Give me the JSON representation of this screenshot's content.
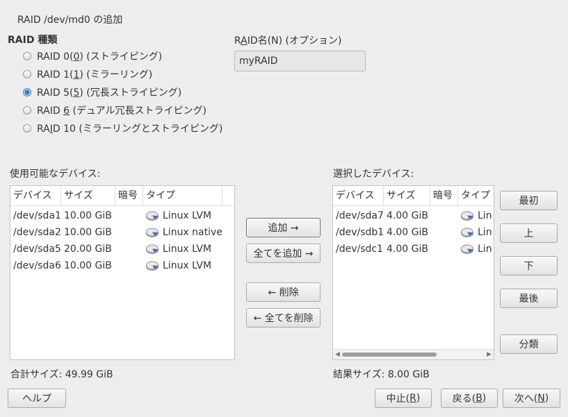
{
  "window": {
    "title": "RAID /dev/md0 の追加"
  },
  "raid_type": {
    "group_label": "RAID 種類",
    "options": [
      {
        "pre": "RAID 0(",
        "key": "0",
        "post": ")  (ストライピング)",
        "checked": false
      },
      {
        "pre": "RAID 1(",
        "key": "1",
        "post": ")  (ミラーリング)",
        "checked": false
      },
      {
        "pre": "RAID 5(",
        "key": "5",
        "post": ")  (冗長ストライピング)",
        "checked": true
      },
      {
        "pre": "RAID ",
        "key": "6",
        "post": " (デュアル冗長ストライピング)",
        "checked": false
      },
      {
        "pre": "RA",
        "key": "I",
        "post": "D 10  (ミラーリングとストライピング)",
        "checked": false
      }
    ]
  },
  "raid_name": {
    "label_pre": "R",
    "label_key": "A",
    "label_post": "ID名(N) (オプション)",
    "value": "myRAID"
  },
  "available": {
    "label": "使用可能なデバイス:",
    "columns": [
      "デバイス",
      "サイズ",
      "暗号",
      "タイプ"
    ],
    "rows": [
      {
        "device": "/dev/sda1",
        "size": "10.00 GiB",
        "enc": "",
        "type": "Linux LVM"
      },
      {
        "device": "/dev/sda2",
        "size": "10.00 GiB",
        "enc": "",
        "type": "Linux native"
      },
      {
        "device": "/dev/sda5",
        "size": "20.00 GiB",
        "enc": "",
        "type": "Linux LVM"
      },
      {
        "device": "/dev/sda6",
        "size": "10.00 GiB",
        "enc": "",
        "type": "Linux LVM"
      }
    ],
    "total": "合計サイズ: 49.99 GiB"
  },
  "selected": {
    "label": "選択したデバイス:",
    "columns": [
      "デバイス",
      "サイズ",
      "暗号",
      "タイプ"
    ],
    "rows": [
      {
        "device": "/dev/sda7",
        "size": "4.00 GiB",
        "enc": "",
        "type": "Lin"
      },
      {
        "device": "/dev/sdb1",
        "size": "4.00 GiB",
        "enc": "",
        "type": "Lin"
      },
      {
        "device": "/dev/sdc1",
        "size": "4.00 GiB",
        "enc": "",
        "type": "Lin"
      }
    ],
    "total": "結果サイズ: 8.00 GiB"
  },
  "transfer_buttons": {
    "add": "追加 →",
    "add_all": "全てを追加 →",
    "remove": "← 削除",
    "remove_all": "← 全てを削除"
  },
  "order_buttons": {
    "top": "最初",
    "up": "上",
    "down": "下",
    "bottom": "最後",
    "sort": "分類"
  },
  "footer": {
    "help": "ヘルプ",
    "abort_pre": "中止(",
    "abort_key": "R",
    "back_pre": "戻る(",
    "back_key": "B",
    "next_pre": "次へ(",
    "next_key": "N",
    "close_paren": ")"
  },
  "icons": {
    "radio": "radio-icon",
    "disk": "hard-disk-icon"
  },
  "colors": {
    "background": "#ededed",
    "radio_checked": "#3c78c8"
  }
}
